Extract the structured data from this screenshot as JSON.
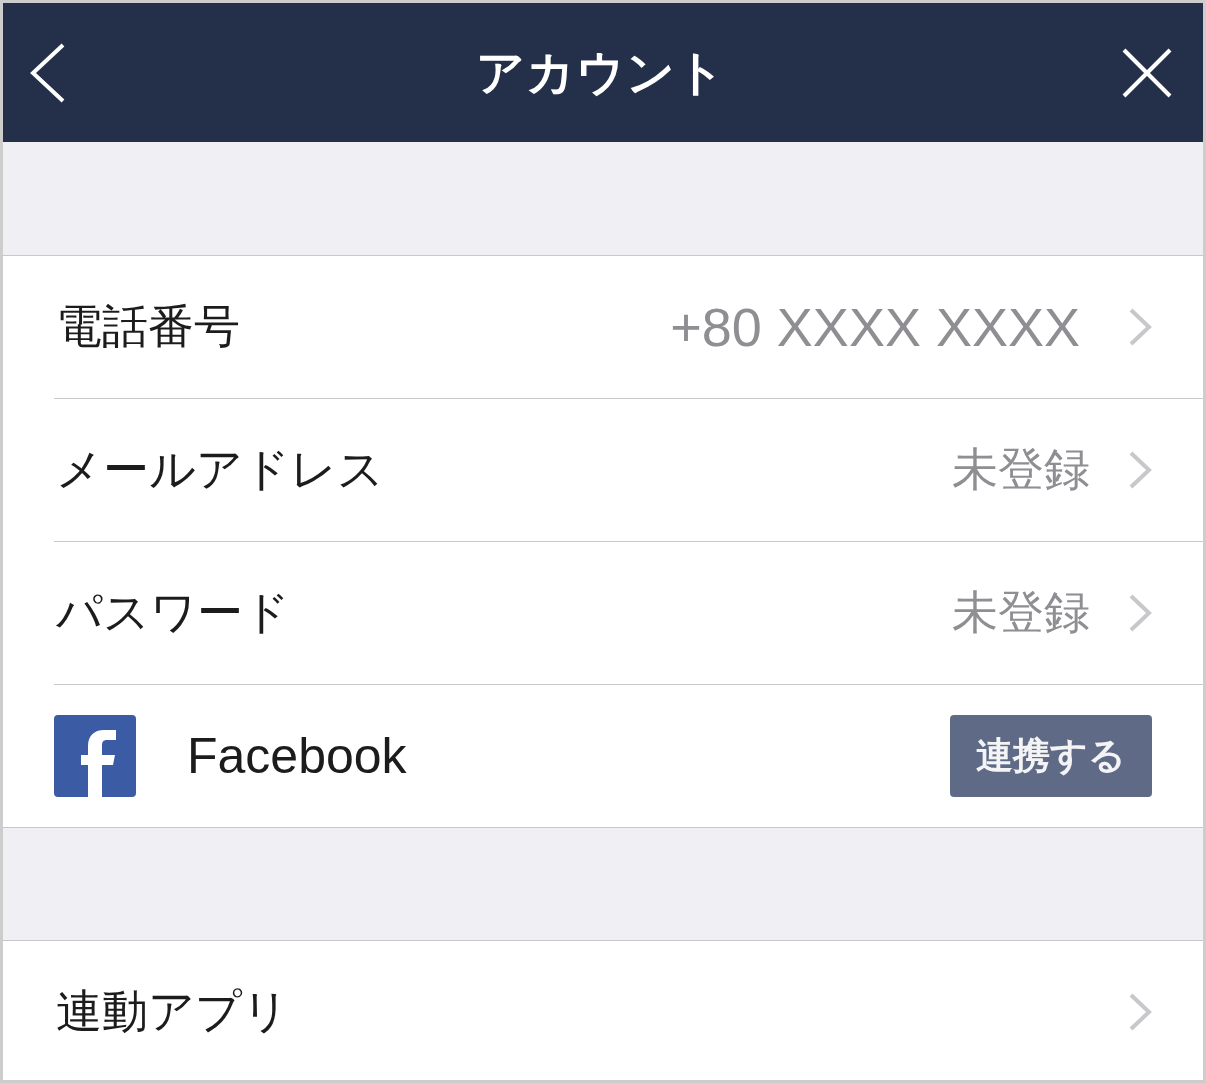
{
  "header": {
    "title": "アカウント"
  },
  "sections": [
    {
      "rows": [
        {
          "kind": "number",
          "label": "電話番号",
          "value": "+80 XXXX XXXX"
        },
        {
          "kind": "value",
          "label": "メールアドレス",
          "value": "未登録"
        },
        {
          "kind": "value",
          "label": "パスワード",
          "value": "未登録"
        },
        {
          "kind": "connect",
          "label": "Facebook",
          "button": "連携する"
        }
      ]
    },
    {
      "rows": [
        {
          "kind": "link",
          "label": "連動アプリ"
        }
      ]
    }
  ]
}
